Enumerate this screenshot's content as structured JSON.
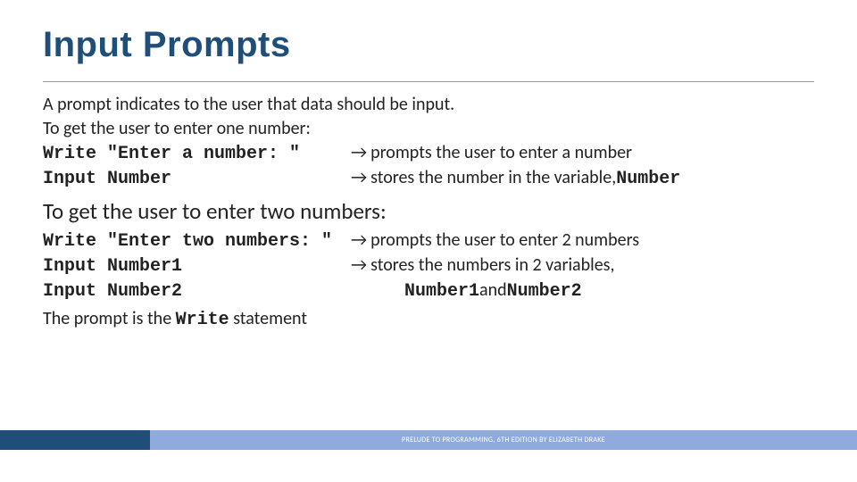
{
  "title": "Input Prompts",
  "p1": "A prompt indicates to the user that data should be input.",
  "p2": "To get the user to enter one number:",
  "ex1": {
    "line1_code": "Write \"Enter a number: \"",
    "line1_arrow": "→",
    "line1_desc": " prompts the user to enter a number",
    "line2_code": "Input Number",
    "line2_arrow": "→",
    "line2_desc_a": " stores the number in the variable, ",
    "line2_desc_b": "Number"
  },
  "subhead": "To get the user to enter two numbers:",
  "ex2": {
    "line1_code": "Write \"Enter two numbers: \"",
    "line1_arrow": "→",
    "line1_desc": " prompts the user to enter 2 numbers",
    "line2_code": "Input Number1",
    "line2_arrow": "→",
    "line2_desc": " stores the numbers in 2 variables,",
    "line3_code": "Input Number2",
    "line3_desc_a": "Number1",
    "line3_desc_mid": " and",
    "line3_desc_b": " Number2"
  },
  "closing_a": "The prompt is the ",
  "closing_b": "Write",
  "closing_c": " statement",
  "footer": "PRELUDE TO PROGRAMMING, 6TH EDITION BY ELIZABETH DRAKE"
}
